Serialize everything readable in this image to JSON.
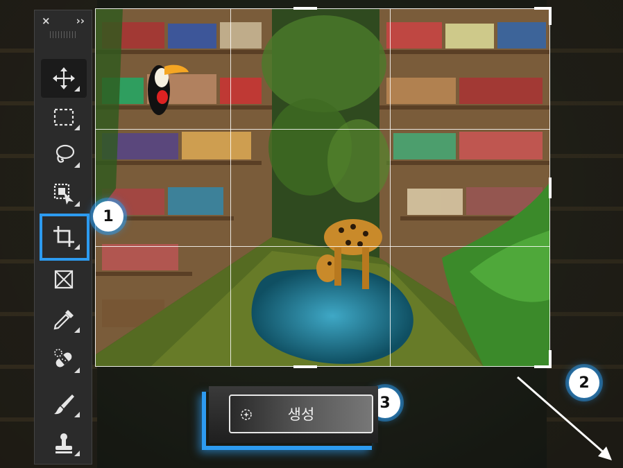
{
  "toolbar": {
    "close_glyph": "×",
    "collapse_glyph": "››",
    "tools": [
      {
        "name": "move-tool",
        "icon": "move-icon"
      },
      {
        "name": "marquee-tool",
        "icon": "rectangular-marquee-icon"
      },
      {
        "name": "lasso-tool",
        "icon": "lasso-icon"
      },
      {
        "name": "object-selection-tool",
        "icon": "object-selection-icon"
      },
      {
        "name": "crop-tool",
        "icon": "crop-icon",
        "active": true
      },
      {
        "name": "frame-tool",
        "icon": "frame-icon"
      },
      {
        "name": "eyedropper-tool",
        "icon": "eyedropper-icon"
      },
      {
        "name": "spot-healing-tool",
        "icon": "spot-healing-bandage-icon"
      },
      {
        "name": "brush-tool",
        "icon": "brush-icon"
      },
      {
        "name": "clone-stamp-tool",
        "icon": "clone-stamp-icon"
      }
    ]
  },
  "callouts": {
    "one": "1",
    "two": "2",
    "three": "3"
  },
  "generate": {
    "label": "생성",
    "icon": "generative-sparkle-icon"
  },
  "colors": {
    "accent": "#2d9bf0",
    "toolbar_bg": "#2b2b2b",
    "grid_line": "#ffffff"
  }
}
